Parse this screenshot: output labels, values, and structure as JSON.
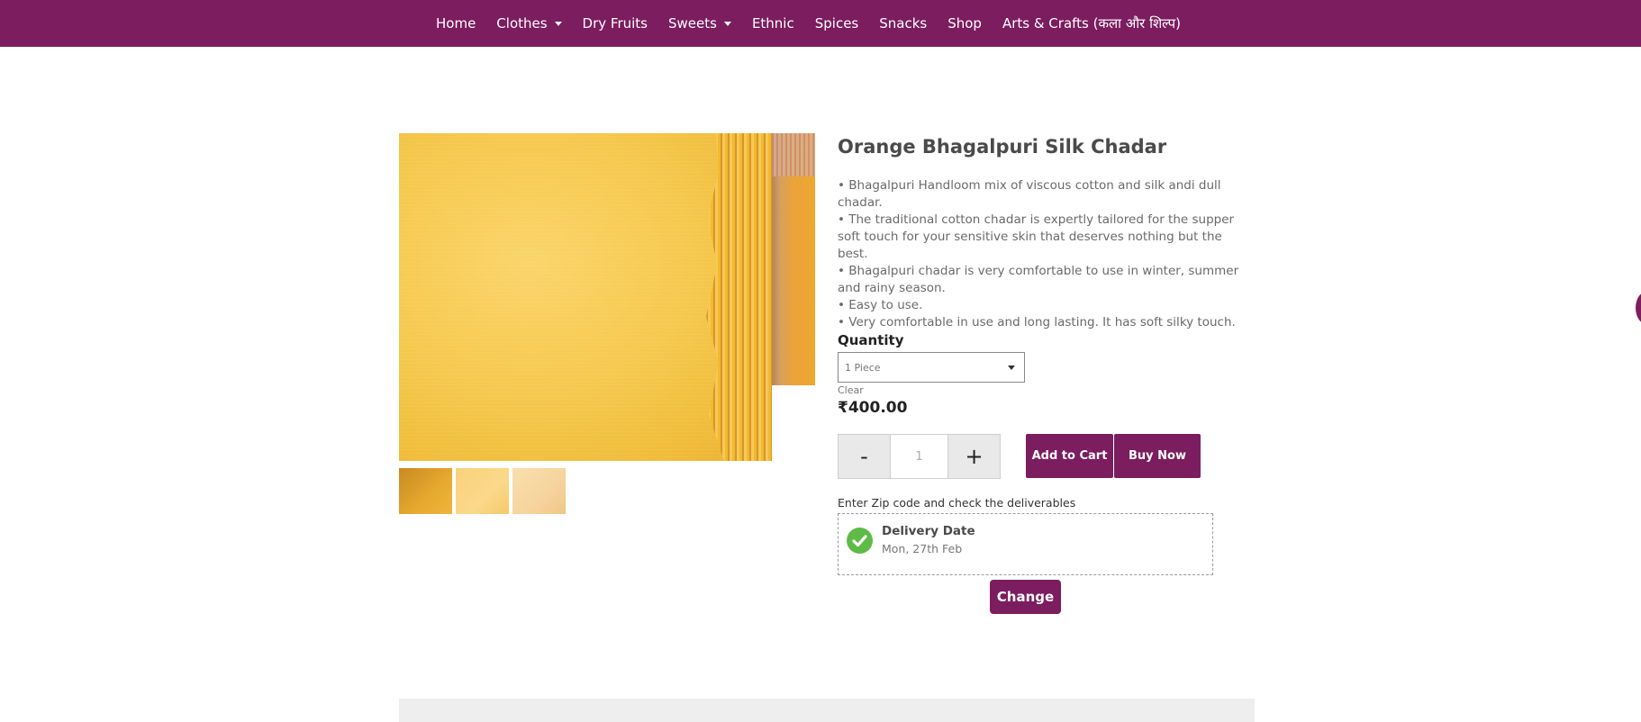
{
  "nav": {
    "items": [
      {
        "label": "Home",
        "has_dropdown": false
      },
      {
        "label": "Clothes",
        "has_dropdown": true
      },
      {
        "label": "Dry Fruits",
        "has_dropdown": false
      },
      {
        "label": "Sweets",
        "has_dropdown": true
      },
      {
        "label": "Ethnic",
        "has_dropdown": false
      },
      {
        "label": "Spices",
        "has_dropdown": false
      },
      {
        "label": "Snacks",
        "has_dropdown": false
      },
      {
        "label": "Shop",
        "has_dropdown": false
      },
      {
        "label": "Arts & Crafts (कला और शिल्प)",
        "has_dropdown": false
      }
    ]
  },
  "product": {
    "title": "Orange Bhagalpuri Silk Chadar",
    "description": [
      "• Bhagalpuri Handloom mix of viscous cotton and silk andi dull chadar.",
      "• The traditional cotton chadar is expertly tailored for the supper soft touch for your sensitive skin that deserves nothing but the best.",
      "• Bhagalpuri chadar is very comfortable to use in winter, summer and rainy season.",
      "• Easy to use.",
      "• Very comfortable in use and long lasting. It has soft silky touch."
    ],
    "quantity_label": "Quantity",
    "quantity_selected": "1 Piece",
    "clear_label": "Clear",
    "price": "₹400.00",
    "stepper": {
      "minus": "-",
      "value": "1",
      "plus": "+"
    },
    "add_to_cart_label": "Add to Cart",
    "buy_now_label": "Buy Now"
  },
  "delivery": {
    "prompt": "Enter Zip code and check the deliverables",
    "title": "Delivery Date",
    "date": "Mon, 27th Feb",
    "change_label": "Change"
  },
  "icons": {
    "dropdown": "caret-down-icon",
    "check": "check-circle-icon"
  },
  "colors": {
    "brand": "#7b1d5f",
    "success": "#5dbb46"
  }
}
